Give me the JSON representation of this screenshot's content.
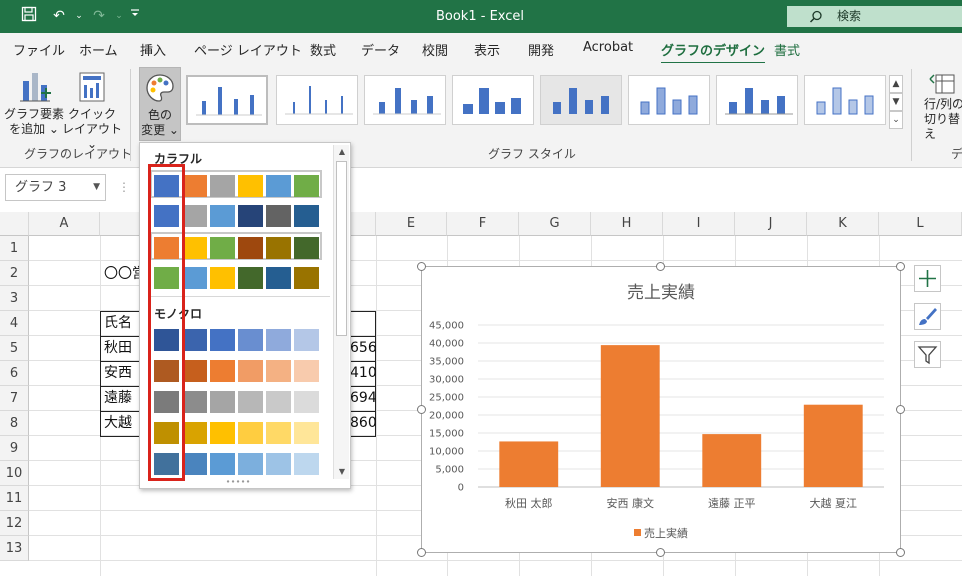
{
  "titlebar": {
    "title": "Book1  -  Excel",
    "search_placeholder": "検索",
    "save_glyph": "💾",
    "undo_glyph": "↶",
    "redo_glyph": "↷",
    "customize_glyph": "⌄"
  },
  "tabs": [
    "ファイル",
    "ホーム",
    "挿入",
    "ページ レイアウト",
    "数式",
    "データ",
    "校閲",
    "表示",
    "開発",
    "Acrobat",
    "グラフのデザイン",
    "書式"
  ],
  "active_tab": "グラフのデザイン",
  "ribbon": {
    "add_element_line1": "グラフ要素",
    "add_element_line2": "を追加 ⌄",
    "quick_layout_line1": "クイック",
    "quick_layout_line2": "レイアウト ⌄",
    "change_colors_line1": "色の",
    "change_colors_line2": "変更 ⌄",
    "group_layout": "グラフのレイアウト",
    "group_styles": "グラフ スタイル",
    "switch_row_col_line1": "行/列の",
    "switch_row_col_line2": "切り替え",
    "group_data_partial": "デ"
  },
  "formula_bar": {
    "name_box": "グラフ 3",
    "dots": "⋮"
  },
  "grid": {
    "columns": [
      "A",
      "B",
      "C",
      "D",
      "E",
      "F",
      "G",
      "H",
      "I",
      "J",
      "K",
      "L"
    ],
    "rows": [
      "1",
      "2",
      "3",
      "4",
      "5",
      "6",
      "7",
      "8",
      "9",
      "10",
      "11",
      "12",
      "13"
    ],
    "b2": "〇〇営",
    "b4": "氏名",
    "b5": "秋田 ",
    "b6": "安西 ",
    "b7": "遠藤 ",
    "b8": "大越 ",
    "d5": "656",
    "d6": "410",
    "d7": "694",
    "d8": "860"
  },
  "color_dropdown": {
    "colorful_label": "カラフル",
    "mono_label": "モノクロ",
    "more_dots": "∙∙∙∙∙",
    "colorful_rows": [
      [
        "#4472C4",
        "#ED7D31",
        "#A5A5A5",
        "#FFC000",
        "#5B9BD5",
        "#70AD47"
      ],
      [
        "#4472C4",
        "#A5A5A5",
        "#5B9BD5",
        "#264478",
        "#636363",
        "#255E91"
      ],
      [
        "#ED7D31",
        "#FFC000",
        "#70AD47",
        "#9E480E",
        "#997300",
        "#43682B"
      ],
      [
        "#70AD47",
        "#5B9BD5",
        "#FFC000",
        "#43682B",
        "#255E91",
        "#997300"
      ]
    ],
    "mono_rows": [
      [
        "#2F5597",
        "#3B64AD",
        "#4472C4",
        "#698ED0",
        "#8FAADC",
        "#B4C7E7"
      ],
      [
        "#AE5A21",
        "#C65F1D",
        "#ED7D31",
        "#F19C65",
        "#F4B183",
        "#F8CBAD"
      ],
      [
        "#7B7B7B",
        "#8C8C8C",
        "#A5A5A5",
        "#B7B7B7",
        "#C9C9C9",
        "#DBDBDB"
      ],
      [
        "#BF9000",
        "#D9A300",
        "#FFC000",
        "#FFCD40",
        "#FFD966",
        "#FFE699"
      ],
      [
        "#41719C",
        "#4A84BE",
        "#5B9BD5",
        "#7CAFDD",
        "#9DC3E6",
        "#BDD7EE"
      ]
    ]
  },
  "chart_data": {
    "type": "bar",
    "title": "売上実績",
    "categories": [
      "秋田 太郎",
      "安西 康文",
      "遠藤 正平",
      "大越 夏江"
    ],
    "series": [
      {
        "name": "売上実績",
        "values": [
          12656,
          39410,
          14694,
          22860
        ],
        "color": "#ED7D31"
      }
    ],
    "ylim": [
      0,
      45000
    ],
    "yticks": [
      0,
      5000,
      10000,
      15000,
      20000,
      25000,
      30000,
      35000,
      40000,
      45000
    ],
    "ytick_labels": [
      "0",
      "5,000",
      "10,000",
      "15,000",
      "20,000",
      "25,000",
      "30,000",
      "35,000",
      "40,000",
      "45,000"
    ],
    "grid": true,
    "legend": "bottom"
  },
  "chart_side_buttons": {
    "elements_glyph": "+",
    "styles_glyph": "🖌",
    "filter_glyph": "⊽"
  },
  "colors": {
    "excel_green": "#217346",
    "accent_red": "#D9231B",
    "bar_orange": "#ED7D31"
  }
}
